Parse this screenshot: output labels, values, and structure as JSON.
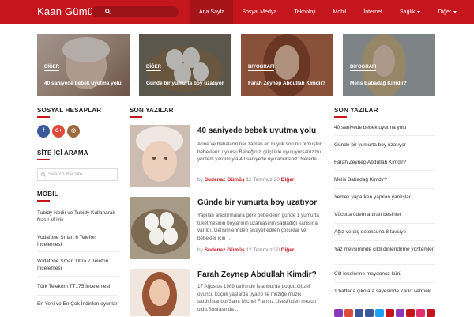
{
  "header": {
    "brand": "Kaan Gümüş",
    "nav": [
      "Ana Sayfa",
      "Sosyal Medya",
      "Teknoloji",
      "Mobil",
      "İnternet",
      "Sağlık",
      "Diğer"
    ]
  },
  "featured": [
    {
      "category": "DİĞER",
      "title": "40 saniyede bebek uyutma yolu"
    },
    {
      "category": "DİĞER",
      "title": "Günde bir yumurta boy uzatıyor"
    },
    {
      "category": "BIYOGRAFI",
      "title": "Farah Zeynep Abdullah Kimdir?"
    },
    {
      "category": "BIYOGRAFI",
      "title": "Melis Babadağ Kimdir?"
    }
  ],
  "sidebar_left": {
    "social_title": "SOSYAL HESAPLAR",
    "social": [
      {
        "icon": "facebook-icon",
        "glyph": "f",
        "color": "#3b5998"
      },
      {
        "icon": "google-plus-icon",
        "glyph": "G+",
        "color": "#dd4b39"
      },
      {
        "icon": "instagram-icon",
        "glyph": "◎",
        "color": "#9c6b3d"
      }
    ],
    "search_title": "SİTE İÇİ ARAMA",
    "search_placeholder": "Search the site",
    "mobile_title": "MOBİL",
    "mobile_items": [
      "Tubidy Nedir ve Tubidy Kullanarak Nasıl Müzik …",
      "Vodafone Smart 6 Telefon İncelemesi",
      "Vodafone Smart Ultra 7 Telefon İncelemesi",
      "Türk Telekom TT175 İncelemesi",
      "En Yeni ve En Çok İndirilen oyunlar"
    ]
  },
  "main": {
    "title": "SON YAZILAR",
    "posts": [
      {
        "title": "40 saniyede bebek uyutma yolu",
        "excerpt": "Anne ve babaların her zaman en büyük sorunu olmuştur bebeklerin uykusu.Bebeğinizi güçlükle uyutuyorsanız bu yöntem yardımıyla 40 saniyede uyutabilirsiniz: Nerede …",
        "by": "by",
        "author": "Sudenaz Gümüş",
        "date": "12 Temmuz 20",
        "category": "Diğer"
      },
      {
        "title": "Günde bir yumurta boy uzatıyor",
        "excerpt": "Yapılan araştırmalara göre bebeklerin günde 1 yumurta tüketmesinin boylarının uzamasının sağladığı kanısına varıldı. Gelişimlerinden şikayet edilen çocuklar ve bebekler için …",
        "by": "by",
        "author": "Sudenaz Gümüş",
        "date": "12 Temmuz 20",
        "category": "Diğer"
      },
      {
        "title": "Farah Zeynep Abdullah Kimdir?",
        "excerpt": "17 Ağustos 1989 tarihinde İstanbul'da doğdu.Güzel oyuncu küçük yaşlarda tiyatro ile müziğe müzik sardı.İstanbul Saint Michel Fransız Lisesi'nden mezun oldu.Sonrasında …"
      }
    ]
  },
  "sidebar_right": {
    "title": "SON YAZILAR",
    "items": [
      "40 saniyede bebek uyutma yolu",
      "Günde bir yumurta boy uzatıyor",
      "Farah Zeynep Abdullah Kimdir?",
      "Melis Babadağ Kimdir?",
      "Yemek yaparken yapılan yanlışlar",
      "Vücutta ödem attıran besinler",
      "Ağız ve diş detoksuna 8 tavsiye",
      "Yaz mevsiminde cildi dinlendirme yöntemleri",
      "Cilt lekelerine maydonoz kürü",
      "1 haftada çikolata sayesinde 7 kilo vermek"
    ],
    "bottom_icons": [
      "#8a3ab9",
      "#dd4b39",
      "#3b5998",
      "#3b5998",
      "#1da1f2",
      "#c4161c",
      "#8a3ab9",
      "#c4161c",
      "#e1306c",
      "#c4161c"
    ]
  },
  "colors": {
    "accent": "#c4161c"
  }
}
